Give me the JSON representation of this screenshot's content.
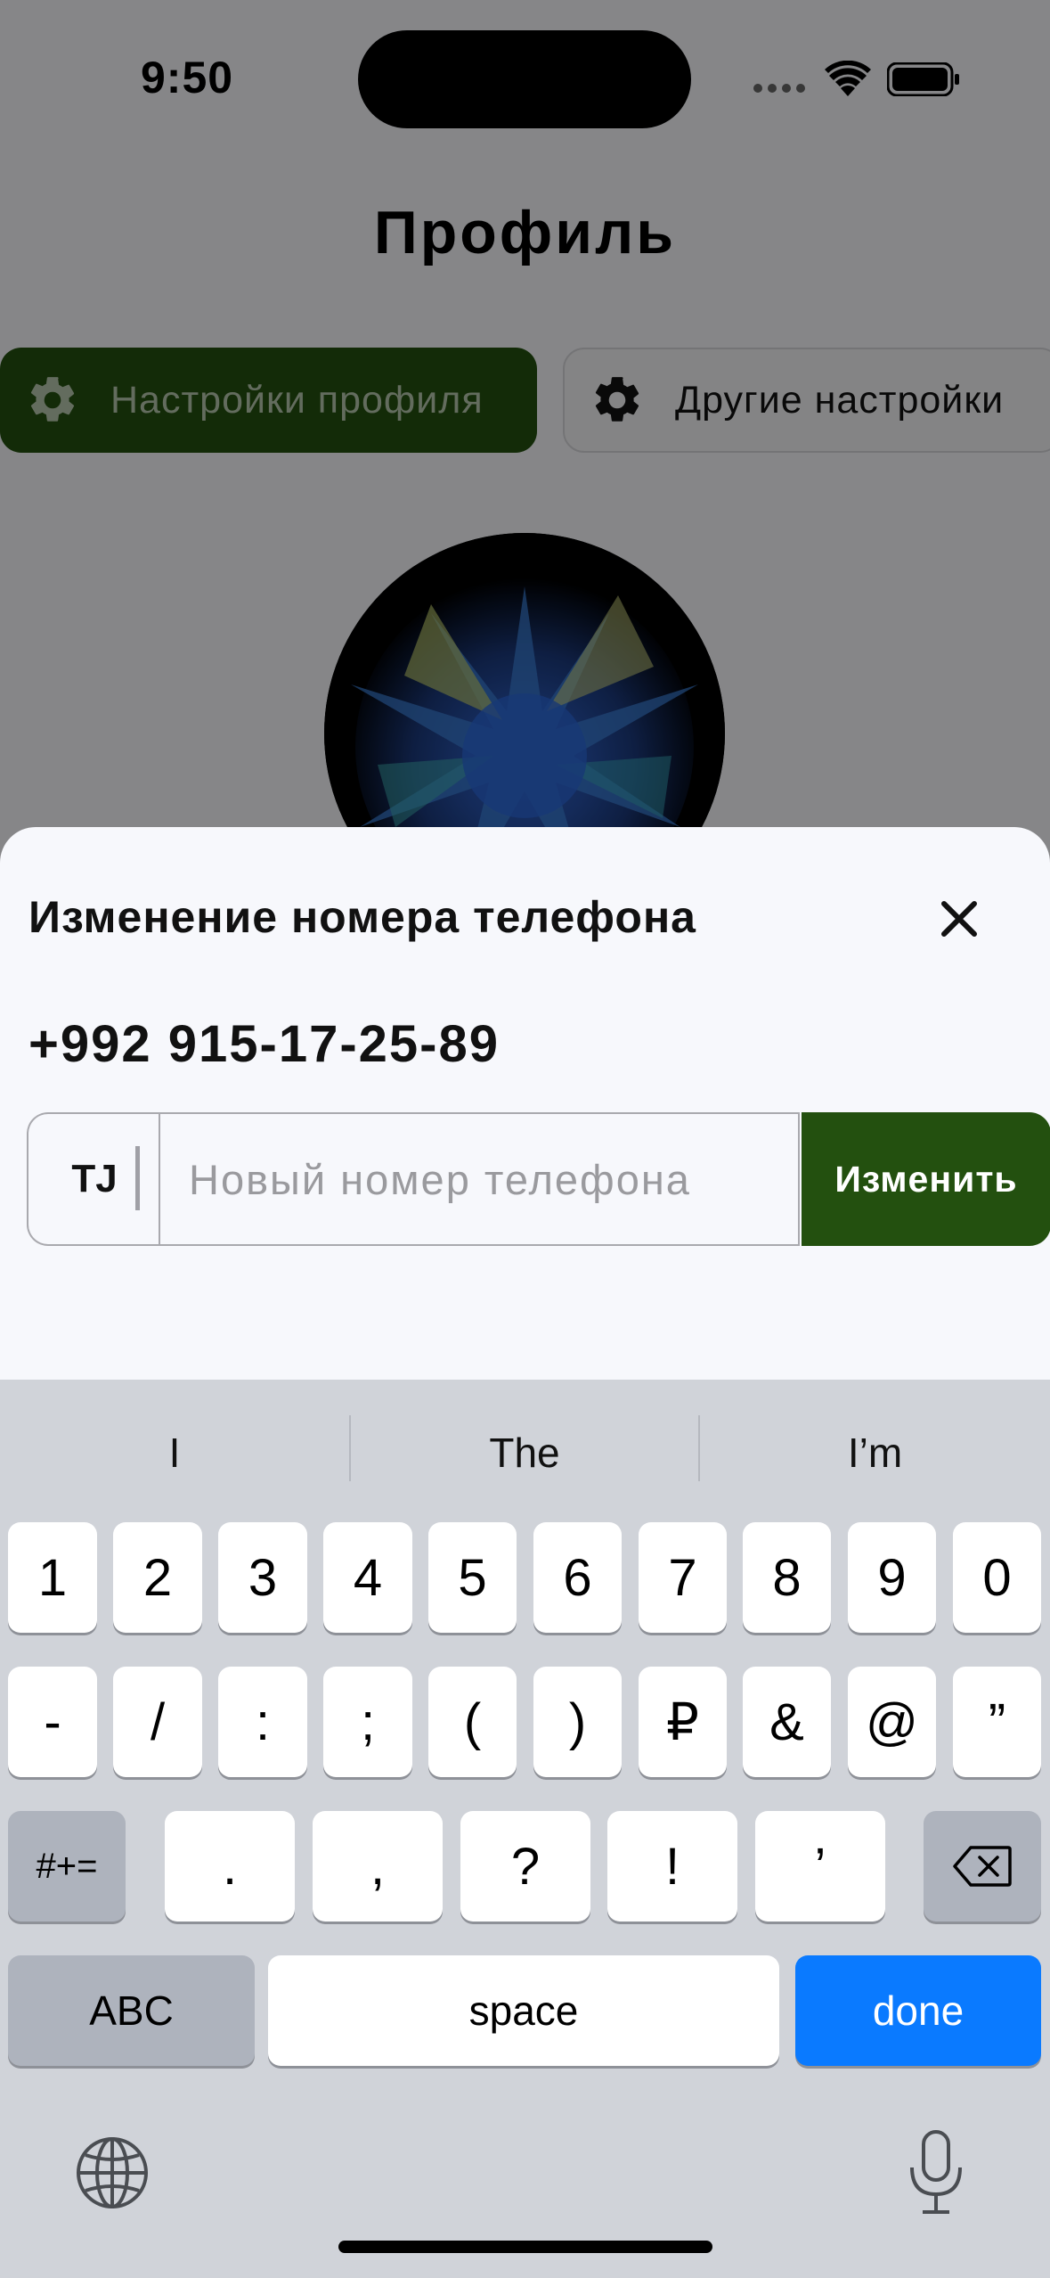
{
  "status_bar": {
    "time": "9:50"
  },
  "page": {
    "title": "Профиль",
    "tabs": [
      {
        "label": "Настройки профиля",
        "active": true
      },
      {
        "label": "Другие настройки",
        "active": false
      }
    ]
  },
  "sheet": {
    "title": "Изменение номера телефона",
    "current_phone": "+992 915-17-25-89",
    "country_code": "TJ",
    "input_placeholder": "Новый номер телефона",
    "input_value": "",
    "submit_label": "Изменить"
  },
  "keyboard": {
    "suggestions": [
      "I",
      "The",
      "I’m"
    ],
    "row1": [
      "1",
      "2",
      "3",
      "4",
      "5",
      "6",
      "7",
      "8",
      "9",
      "0"
    ],
    "row2": [
      "-",
      "/",
      ":",
      ";",
      "(",
      ")",
      "₽",
      "&",
      "@",
      "”"
    ],
    "row3": [
      ".",
      ",",
      "?",
      "!",
      "’"
    ],
    "symbols_key": "#+=",
    "abc_key": "ABC",
    "space_key": "space",
    "done_key": "done"
  },
  "colors": {
    "accent_green": "#23500f",
    "ios_blue": "#0a7aff",
    "sheet_bg": "#f7f8fc",
    "keyboard_bg": "#d0d3d9"
  },
  "icons": [
    "wifi-icon",
    "battery-icon",
    "gear-icon",
    "close-icon",
    "backspace-icon",
    "globe-icon",
    "microphone-icon"
  ]
}
